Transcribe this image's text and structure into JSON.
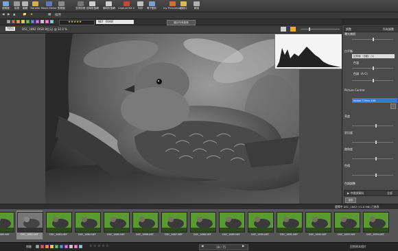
{
  "toolbar": {
    "buttons": [
      {
        "label": "瀏覽器",
        "color": "#7aa4d8"
      },
      {
        "label": "檢視",
        "color": "#9a9a9a"
      },
      {
        "label": "編輯",
        "color": "#b6b6b6"
      },
      {
        "label": "Transfer",
        "color": "#d8b04a"
      },
      {
        "label": "Movie Editor",
        "color": "#5c78c0"
      },
      {
        "label": "對照圖",
        "color": "#8a8a8a"
      },
      {
        "label": "並排檢視",
        "color": "#777"
      },
      {
        "label": "逆時針旋轉",
        "color": "#d0d0d0"
      },
      {
        "label": "順時針旋轉",
        "color": "#d0d0d0"
      },
      {
        "label": "Capture NX 2",
        "color": "#c04a3a"
      },
      {
        "label": "列印",
        "color": "#bfbfbf"
      },
      {
        "label": "電子郵件",
        "color": "#7ca0cc"
      },
      {
        "label": "my Picturetown",
        "color": "#d86a2a"
      },
      {
        "label": "記錄片",
        "color": "#e0b84a"
      },
      {
        "label": "轉換",
        "color": "#b0b0b0"
      }
    ]
  },
  "nav": {
    "back": "◀",
    "forward": "▶",
    "up": "▲",
    "buttons": [
      "📁",
      "★"
    ],
    "sort_label": "排序",
    "view_label": "▦"
  },
  "labelbar": {
    "labels": [
      {
        "text": "0",
        "color": "#8a8a8a"
      },
      {
        "text": "1",
        "color": "#d23c3c"
      },
      {
        "text": "2",
        "color": "#e07a2a"
      },
      {
        "text": "3",
        "color": "#d8c030"
      },
      {
        "text": "4",
        "color": "#4aa04a"
      },
      {
        "text": "5",
        "color": "#3a6ad0"
      },
      {
        "text": "6",
        "color": "#b050c0"
      },
      {
        "text": "7",
        "color": "#c0c0c0"
      },
      {
        "text": "8",
        "color": "#d06ab0"
      },
      {
        "text": "9",
        "color": "#6ab8d0"
      }
    ],
    "stars": "★★★★★",
    "menu_value": "NEF（RAW）",
    "right_button": "顯示所有影像"
  },
  "viewer": {
    "title_badge": "7051",
    "file_info": "DSC_1882 (RGB 8位元) @ 32.0 %",
    "histogram_label": "直方圖"
  },
  "panel": {
    "tab_left": "調整",
    "tab_right": "所有調整",
    "section_exposure": "曝光補償",
    "section_wb": "白平衡",
    "wb_value": "記錄值（自動）(1)",
    "wb_sub1": "色溫",
    "wb_sub2": "色調（A-G）",
    "section_pc": "Picture Control",
    "pc_value": "Kodak T-Max 400",
    "section_contrast": "亮度",
    "section_sharp": "對比度",
    "section_sat": "飽和度",
    "section_hue": "色相",
    "section_adj": "色調調整",
    "collapse_label": "▶ 中間調資料",
    "bottom_left": "重設",
    "bottom_right": "全部"
  },
  "filmstrip": {
    "info": "選擇中 DSC_1882 (11.8 MB) 已修改",
    "thumbs": [
      "DSC_1880.NEF",
      "DSC_1882.NEF",
      "DSC_1883.NEF",
      "DSC_1884.NEF",
      "DSC_1885.NEF",
      "DSC_1886.NEF",
      "DSC_1887.NEF",
      "DSC_1888.NEF",
      "DSC_1889.NEF",
      "DSC_1890.NEF",
      "DSC_1891.NEF",
      "DSC_1892.NEF",
      "DSC_1893.NEF",
      "DSC_1894.NEF"
    ],
    "selected_index": 1
  },
  "bottombar": {
    "label_text": "標籤",
    "page_counter": "18 / 75",
    "right_text": "回到原本相片"
  }
}
